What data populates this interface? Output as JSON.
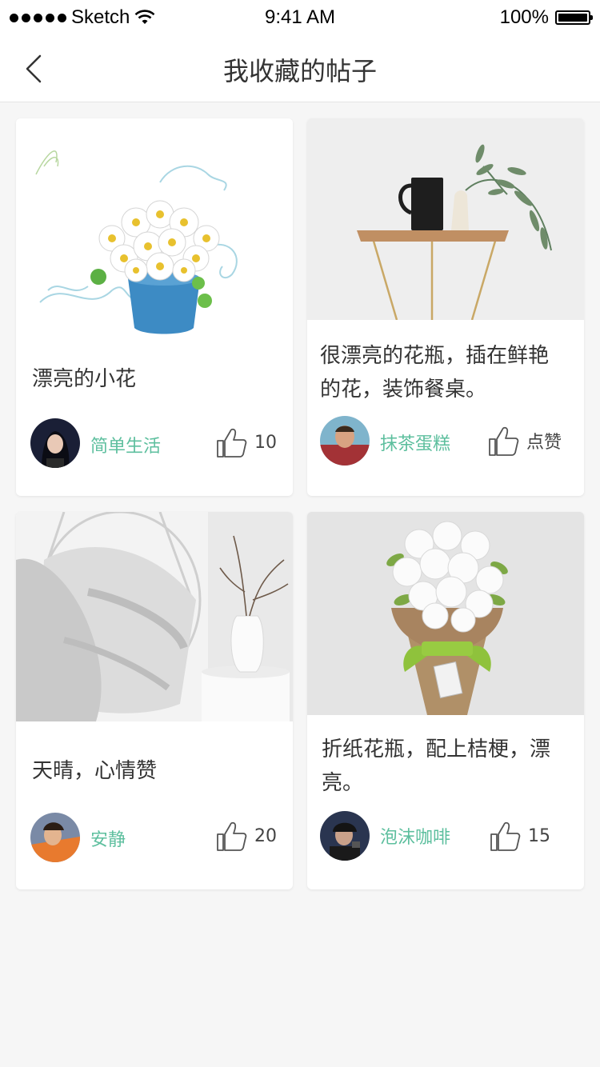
{
  "status_bar": {
    "carrier": "Sketch",
    "time": "9:41 AM",
    "battery": "100%"
  },
  "nav": {
    "title": "我收藏的帖子"
  },
  "posts": [
    {
      "title": "漂亮的小花",
      "author": "简单生活",
      "likes": "10"
    },
    {
      "title": "很漂亮的花瓶，插在鲜艳的花，装饰餐桌。",
      "author": "抹茶蛋糕",
      "likes": "点赞"
    },
    {
      "title": "天晴，心情赞",
      "author": "安静",
      "likes": "20"
    },
    {
      "title": "折纸花瓶，配上桔梗，漂亮。",
      "author": "泡沫咖啡",
      "likes": "15"
    }
  ]
}
